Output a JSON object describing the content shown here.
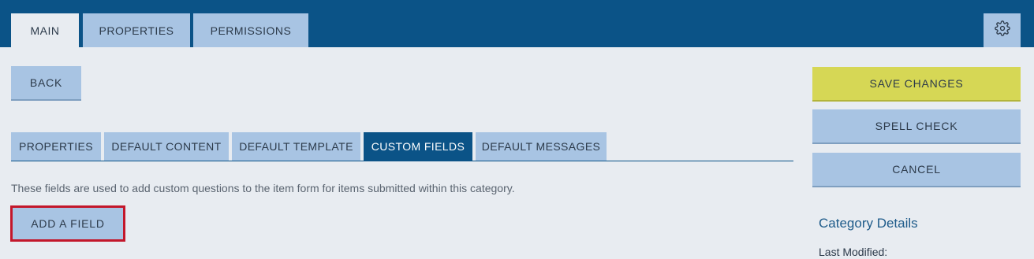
{
  "top_tabs": [
    {
      "label": "MAIN",
      "active": true
    },
    {
      "label": "PROPERTIES",
      "active": false
    },
    {
      "label": "PERMISSIONS",
      "active": false
    }
  ],
  "settings_icon": "gear-icon",
  "back_label": "BACK",
  "actions": {
    "save_label": "SAVE CHANGES",
    "spell_check_label": "SPELL CHECK",
    "cancel_label": "CANCEL"
  },
  "sub_tabs": [
    {
      "label": "PROPERTIES",
      "active": false
    },
    {
      "label": "DEFAULT CONTENT",
      "active": false
    },
    {
      "label": "DEFAULT TEMPLATE",
      "active": false
    },
    {
      "label": "CUSTOM FIELDS",
      "active": true
    },
    {
      "label": "DEFAULT MESSAGES",
      "active": false
    }
  ],
  "description": "These fields are used to add custom questions to the item form for items submitted within this category.",
  "add_field_label": "ADD A FIELD",
  "category_details": {
    "title": "Category Details",
    "last_modified_label": "Last Modified:"
  },
  "colors": {
    "header_blue": "#0b5387",
    "tab_light_blue": "#a8c4e3",
    "save_yellow": "#d6d755",
    "highlight_red": "#c3172b",
    "background": "#e8ecf1"
  }
}
